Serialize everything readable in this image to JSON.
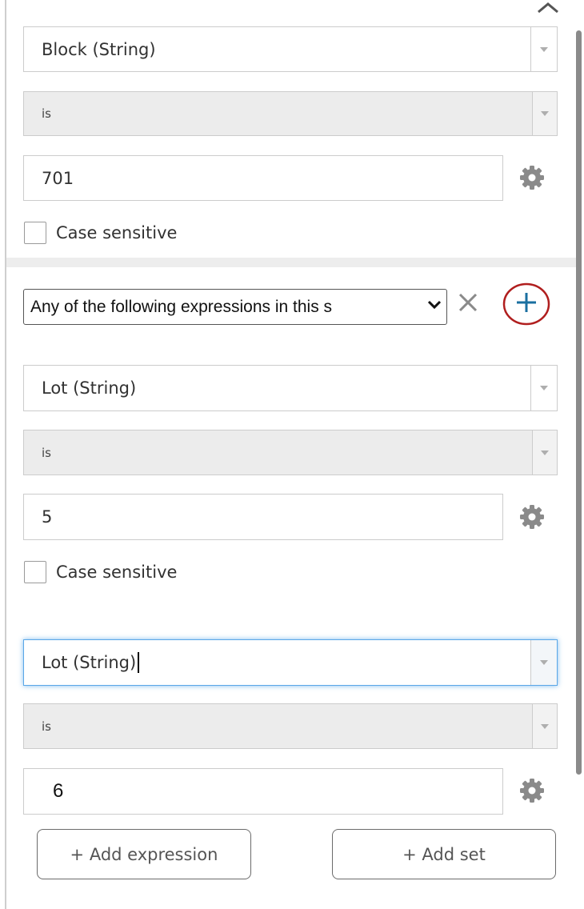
{
  "expression1": {
    "field": "Block (String)",
    "operator": "is",
    "value": "701",
    "case_sensitive_label": "Case sensitive"
  },
  "set": {
    "mode": "Any of the following expressions in this s",
    "close_icon": "close-icon",
    "add_icon": "plus-icon",
    "expression1": {
      "field": "Lot (String)",
      "operator": "is",
      "value": "5",
      "case_sensitive_label": "Case sensitive"
    },
    "expression2": {
      "field": "Lot (String)",
      "operator": "is",
      "value": "6"
    }
  },
  "actions": {
    "add_expression": "+ Add expression",
    "add_set": "+ Add set"
  },
  "colors": {
    "plus_icon": "#1a6fa0",
    "highlight_circle": "#b01e1e",
    "active_border": "#5aa7e8"
  }
}
